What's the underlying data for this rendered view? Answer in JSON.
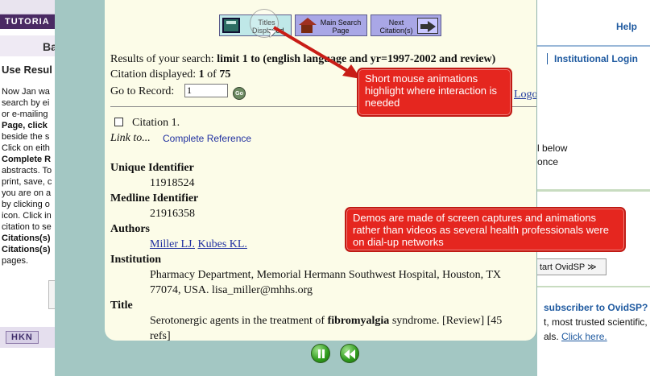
{
  "bg_tutorial": {
    "bar_text": "TUTORIA",
    "heading_fragment": "Ba",
    "section_title": "Use Resul",
    "body_lines": [
      "Now Jan wa",
      "search by ei",
      "or e-mailing",
      "Page, click",
      "beside the s",
      "Click on eith",
      "Complete R",
      "abstracts. To",
      "print, save, c",
      "you are on a",
      "by clicking o",
      "icon. Click in",
      "citation to se",
      "Citations(s)",
      "Citations(s)",
      "pages."
    ],
    "hkn_label": "HKN"
  },
  "bg_ovid": {
    "help": "Help",
    "institutional_login": "Institutional Login",
    "below_text": "l below",
    "once_text": "once",
    "start_button": "tart OvidSP ≫",
    "subscriber_text": "subscriber to OvidSP? A",
    "trusted_text": "t, most trusted scientific,",
    "click_prefix": "als.",
    "click_here": "Click here."
  },
  "toolbar": {
    "titles_label": "Titles Displayed",
    "main_label": "Main Search Page",
    "next_label": "Next Citation(s)"
  },
  "search": {
    "results_prefix": "Results of your search:",
    "results_query": "limit 1 to (english language and yr=1997-2002 and review)",
    "cit_prefix": "Citation displayed:",
    "cit_value": "1",
    "cit_of": "of",
    "cit_total": "75",
    "goto_label": "Go to Record:",
    "goto_value": "1",
    "go_button": "Go",
    "logoff": "Logo"
  },
  "citation": {
    "label": "Citation 1.",
    "link_to": "Link to...",
    "complete_reference": "Complete Reference",
    "unique_identifier_label": "Unique Identifier",
    "unique_identifier": "11918524",
    "medline_identifier_label": "Medline Identifier",
    "medline_identifier": "21916358",
    "authors_label": "Authors",
    "author_1": "Miller LJ.",
    "author_2": "Kubes KL.",
    "institution_label": "Institution",
    "institution_line1": "Pharmacy Department, Memorial Hermann Southwest Hospital, Houston, TX",
    "institution_line2": "77074, USA. lisa_miller@mhhs.org",
    "title_label": "Title",
    "title_before": "Serotonergic agents in the treatment of",
    "title_bold": "fibromyalgia",
    "title_after": "syndrome. [Review] [45",
    "title_line2": "refs]"
  },
  "callouts": {
    "mouse": "Short mouse animations highlight where interaction is needed",
    "demos": "Demos are made of screen captures and animations rather than videos as several health professionals were on dial-up networks"
  },
  "colors": {
    "callout": "#e5261f",
    "player_frame": "#a3c7c3",
    "viewport": "#fcfce8",
    "link": "#2030a0"
  }
}
